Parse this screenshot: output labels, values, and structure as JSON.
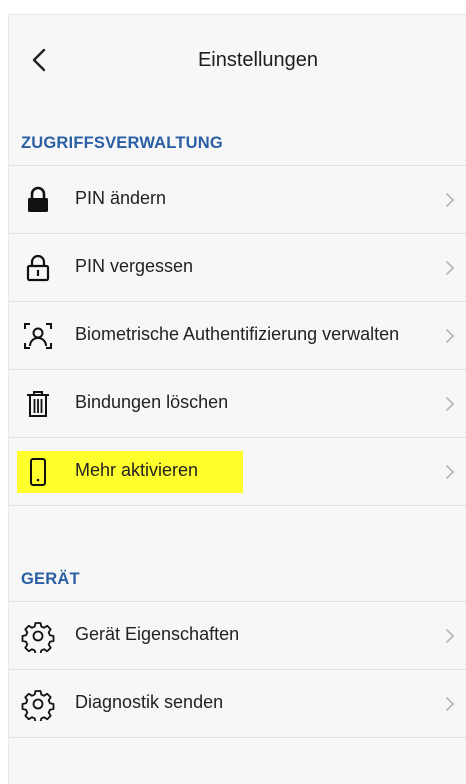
{
  "header": {
    "title": "Einstellungen"
  },
  "sections": {
    "access": {
      "title": "ZUGRIFFSVERWALTUNG",
      "items": [
        {
          "label": "PIN ändern",
          "icon": "lock-closed-icon"
        },
        {
          "label": "PIN vergessen",
          "icon": "lock-open-icon"
        },
        {
          "label": "Biometrische Authentifizierung verwalten",
          "icon": "face-scan-icon"
        },
        {
          "label": "Bindungen löschen",
          "icon": "trash-icon"
        },
        {
          "label": "Mehr aktivieren",
          "icon": "phone-icon",
          "highlighted": true,
          "highlight_color": "#ffff2e"
        }
      ]
    },
    "device": {
      "title": "GERÄT",
      "items": [
        {
          "label": "Gerät Eigenschaften",
          "icon": "gear-icon"
        },
        {
          "label": "Diagnostik senden",
          "icon": "gear-icon"
        }
      ]
    }
  },
  "colors": {
    "section_title": "#2a5fa3",
    "background": "#f7f7f7",
    "divider": "#e0e0e0"
  }
}
